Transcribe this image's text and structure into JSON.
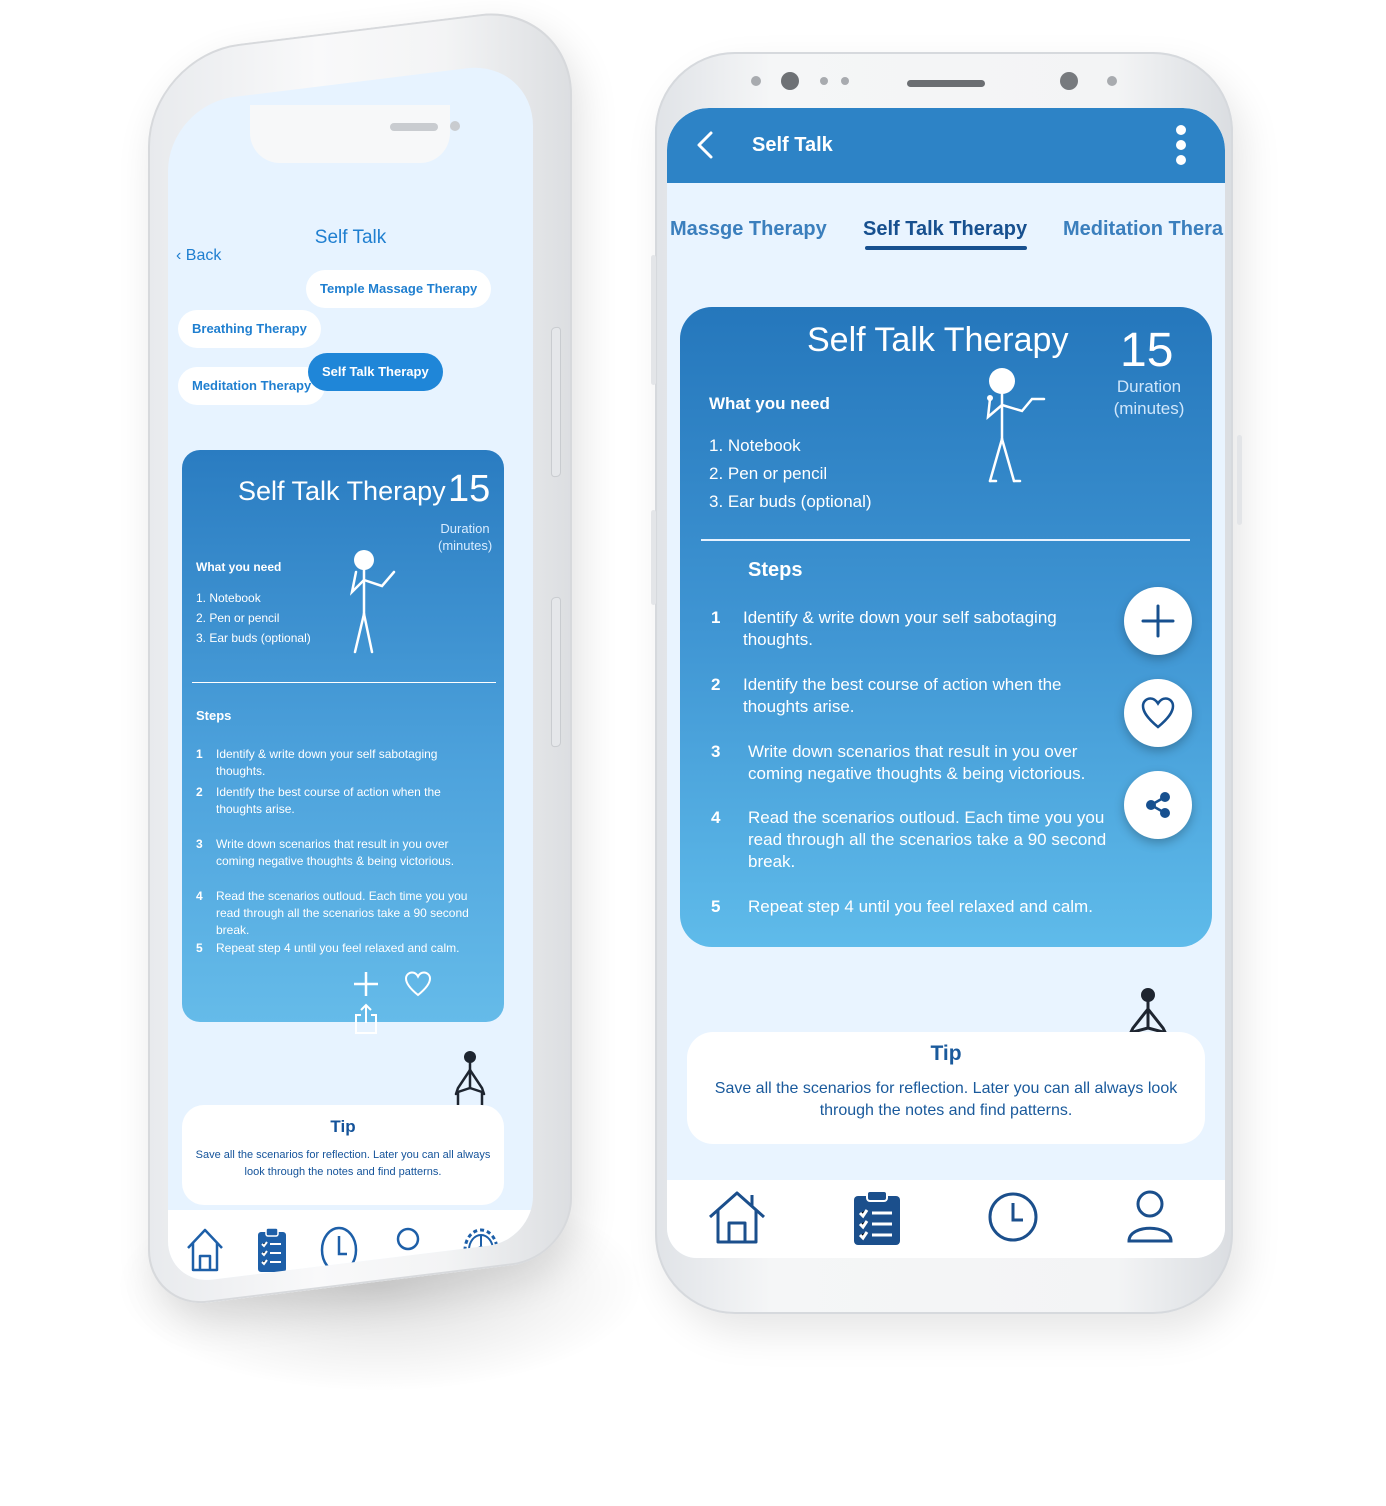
{
  "left_phone": {
    "title": "Self Talk",
    "back_label": "Back",
    "therapy_pills": [
      {
        "label": "Breathing Therapy",
        "active": false
      },
      {
        "label": "Temple Massage Therapy",
        "active": false
      },
      {
        "label": "Meditation Therapy",
        "active": false
      },
      {
        "label": "Self Talk Therapy",
        "active": true
      }
    ],
    "card": {
      "title": "Self Talk Therapy",
      "duration_value": "15",
      "duration_label": "Duration (minutes)",
      "need_heading": "What you need",
      "needs": [
        "1. Notebook",
        "2. Pen or pencil",
        "3. Ear buds (optional)"
      ],
      "steps_heading": "Steps",
      "steps": [
        {
          "num": "1",
          "text": "Identify & write down your self sabotaging thoughts."
        },
        {
          "num": "2",
          "text": "Identify the best course of action when the thoughts arise."
        },
        {
          "num": "3",
          "text": "Write down scenarios that result in you over coming negative thoughts & being victorious."
        },
        {
          "num": "4",
          "text": "Read the scenarios outloud. Each time you you read through all the scenarios take a 90 second break."
        },
        {
          "num": "5",
          "text": "Repeat step 4 until you feel relaxed and calm."
        }
      ],
      "action_icons": [
        "plus-icon",
        "heart-icon",
        "share-icon"
      ]
    },
    "tip": {
      "heading": "Tip",
      "text": "Save all the scenarios for reflection. Later you can all always look through the notes and find patterns."
    },
    "bottom_nav": [
      "home-icon",
      "clipboard-icon",
      "clock-icon",
      "user-icon",
      "settings-icon"
    ]
  },
  "right_phone": {
    "app_bar_title": "Self Talk",
    "tabs": [
      {
        "label": "Massge Therapy",
        "active": false
      },
      {
        "label": "Self Talk Therapy",
        "active": true
      },
      {
        "label": "Meditation Thera",
        "active": false
      }
    ],
    "card": {
      "title": "Self Talk Therapy",
      "duration_value": "15",
      "duration_word": "Duration",
      "duration_unit": "(minutes)",
      "need_heading": "What you need",
      "needs": [
        "1.  Notebook",
        "2.  Pen or pencil",
        "3.  Ear buds (optional)"
      ],
      "steps_heading": "Steps",
      "steps": [
        {
          "num": "1",
          "text": "Identify & write down your self sabotaging thoughts."
        },
        {
          "num": "2",
          "text": "Identify the best course of action when the thoughts arise."
        },
        {
          "num": "3",
          "text": "Write down scenarios that result in you over coming negative thoughts & being victorious."
        },
        {
          "num": "4",
          "text": "Read the scenarios outloud. Each time you you read through all the scenarios take a 90 second break."
        },
        {
          "num": "5",
          "text": "Repeat step 4 until you feel relaxed and calm."
        }
      ]
    },
    "fabs": [
      "plus-icon",
      "heart-icon",
      "share-icon"
    ],
    "tip": {
      "heading": "Tip",
      "text": "Save all the scenarios for reflection. Later you can all always look through the notes and find patterns."
    },
    "bottom_nav": [
      "home-icon",
      "clipboard-icon",
      "clock-icon",
      "user-icon"
    ]
  },
  "colors": {
    "primary_blue": "#2d83c6",
    "dark_blue": "#17508f",
    "screen_bg": "#e9f4ff",
    "card_gradient_top": "#2577bc",
    "card_gradient_bottom": "#5fbbea"
  }
}
